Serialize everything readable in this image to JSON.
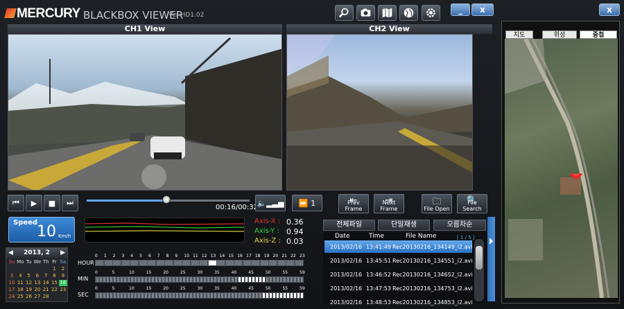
{
  "app": {
    "brand": "MERCURY",
    "title": "BLACKBOX VIEWER",
    "version": "Ver HD1.02"
  },
  "toolbar": {
    "buttons": [
      "search-zoom-icon",
      "camera-icon",
      "map-icon",
      "globe-icon",
      "gear-icon"
    ],
    "minimize": "_",
    "close": "x",
    "map_close": "x"
  },
  "channels": {
    "ch1": "CH1 View",
    "ch2": "CH2 View"
  },
  "playback": {
    "progress": 0.49,
    "time": "00:16/00:32",
    "volume_icon": "speaker-icon",
    "speed_button": "1",
    "prev_frame": "Prev Frame",
    "next_frame": "Next Frame",
    "file_open": "File Open",
    "file_search": "File Search"
  },
  "speed": {
    "label": "Speed",
    "value": "10",
    "unit": "Km/h"
  },
  "axes": [
    {
      "label": "Axis-X :",
      "value": "0.36",
      "color": "#e03232"
    },
    {
      "label": "Axis-Y :",
      "value": "0.94",
      "color": "#38d038"
    },
    {
      "label": "Axis-Z :",
      "value": "0.03",
      "color": "#e0d040"
    }
  ],
  "file_tabs": [
    "전체파일",
    "단일재생",
    "오름차순"
  ],
  "file_list": {
    "headers": {
      "date": "Date",
      "time": "Time",
      "name": "File Name"
    },
    "page": "[ 1 / 5 ]",
    "rows": [
      {
        "date": "2013/02/16",
        "time": "13:41:49",
        "name": "Rec20130216_134149_l2.avi",
        "selected": true
      },
      {
        "date": "2013/02/16",
        "time": "13:45:51",
        "name": "Rec20130216_134551_l2.avi",
        "selected": false
      },
      {
        "date": "2013/02/16",
        "time": "13:46:52",
        "name": "Rec20130216_134652_l2.avi",
        "selected": false
      },
      {
        "date": "2013/02/16",
        "time": "13:47:53",
        "name": "Rec20130216_134753_l2.avi",
        "selected": false
      },
      {
        "date": "2013/02/16",
        "time": "13:48:53",
        "name": "Rec20130216_134853_l2.avi",
        "selected": false
      }
    ]
  },
  "calendar": {
    "title": "2013, 2",
    "days": [
      "Su",
      "Mo",
      "Tu",
      "We",
      "Th",
      "Fr",
      "Sa"
    ],
    "weeks": [
      [
        "",
        "",
        "",
        "",
        "",
        "1",
        "2"
      ],
      [
        "3",
        "4",
        "5",
        "6",
        "7",
        "8",
        "9"
      ],
      [
        "10",
        "11",
        "12",
        "13",
        "14",
        "15",
        "16"
      ],
      [
        "17",
        "18",
        "19",
        "20",
        "21",
        "22",
        "23"
      ],
      [
        "24",
        "25",
        "26",
        "27",
        "28",
        "",
        ""
      ]
    ],
    "selected": "16"
  },
  "timeline": {
    "hour_label": "HOUR",
    "min_label": "MIN",
    "sec_label": "SEC",
    "hour_ticks": [
      "0",
      "1",
      "2",
      "3",
      "4",
      "5",
      "6",
      "7",
      "8",
      "9",
      "10",
      "11",
      "12",
      "13",
      "14",
      "15",
      "16",
      "17",
      "18",
      "19",
      "20",
      "21",
      "22",
      "23"
    ],
    "min_ticks": [
      "0",
      "5",
      "10",
      "15",
      "20",
      "25",
      "30",
      "35",
      "40",
      "45",
      "50",
      "55",
      "59"
    ],
    "sec_ticks": [
      "0",
      "5",
      "10",
      "15",
      "20",
      "25",
      "30",
      "35",
      "40",
      "45",
      "50",
      "55",
      "59"
    ],
    "active_hour": 13
  },
  "map": {
    "tabs": [
      "지도",
      "위성",
      "중첩"
    ],
    "active_tab": 2
  }
}
